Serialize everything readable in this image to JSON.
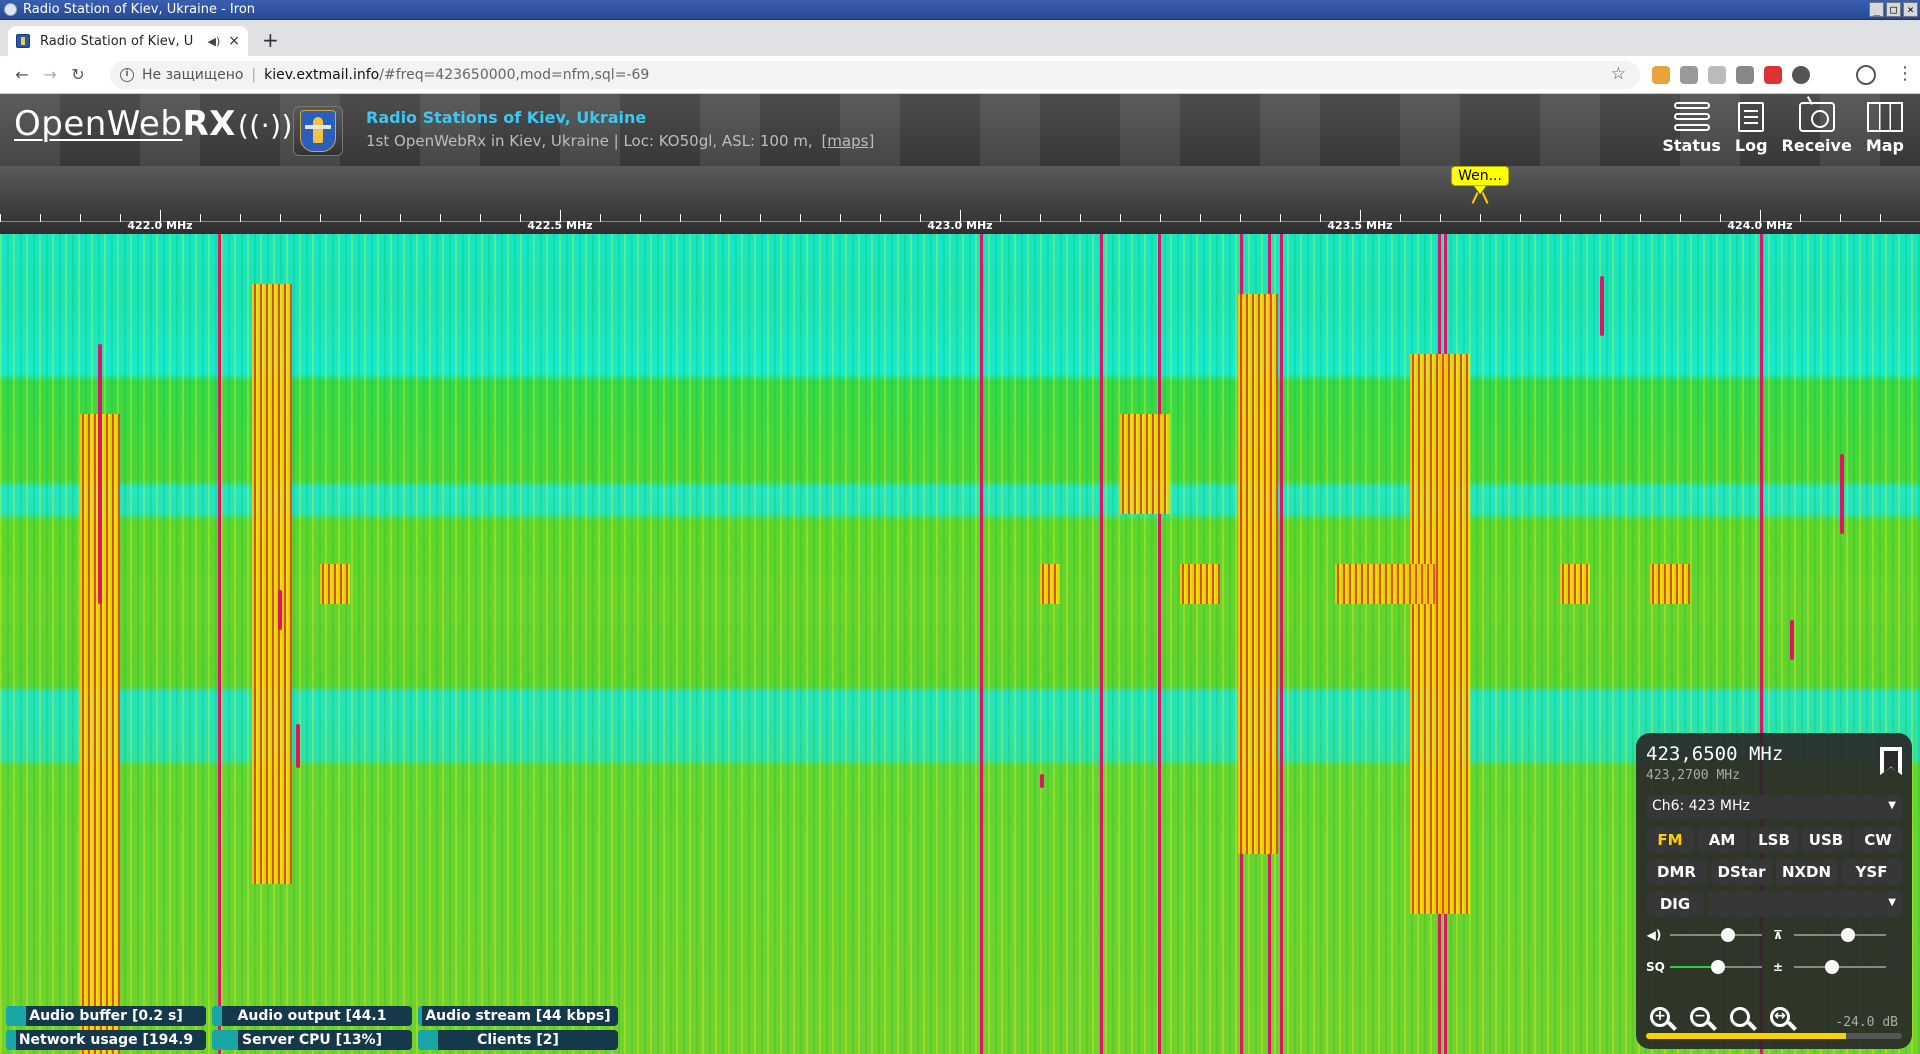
{
  "window": {
    "title": "Radio Station of Kiev, Ukraine - Iron"
  },
  "tab": {
    "title": "Radio Station of Kiev, U",
    "close": "×"
  },
  "newtab": "+",
  "addressbar": {
    "insecure_label": "Не защищено",
    "separator": "|",
    "host": "kiev.extmail.info",
    "path": "/#freq=423650000,mod=nfm,sql=-69"
  },
  "header": {
    "logo_thin": "OpenWeb",
    "logo_bold": "RX",
    "logo_waves": "((·))",
    "title": "Radio Stations of Kiev, Ukraine",
    "description": "1st OpenWebRx in Kiev, Ukraine | Loc: KO50gl, ASL: 100 m,",
    "maps_link": "[maps]",
    "buttons": [
      {
        "label": "Status"
      },
      {
        "label": "Log"
      },
      {
        "label": "Receive"
      },
      {
        "label": "Map"
      }
    ]
  },
  "scale": {
    "labels": [
      "422.0 MHz",
      "422.5 MHz",
      "423.0 MHz",
      "423.5 MHz",
      "424.0 MHz"
    ],
    "bookmark_label": "Wen..."
  },
  "receiver": {
    "frequency": "423,6500 MHz",
    "offset_frequency": "423,2700 MHz",
    "channel_select": "Ch6: 423 MHz",
    "modes_row1": [
      "FM",
      "AM",
      "LSB",
      "USB",
      "CW"
    ],
    "modes_row2": [
      "DMR",
      "DStar",
      "NXDN",
      "YSF"
    ],
    "dig_label": "DIG",
    "active_mode": "FM",
    "volume_level": 0.65,
    "squelch_level": 0.52,
    "gain_level": 0.4,
    "ns_level": 0.6,
    "smeter_label": "-24.0 dB",
    "smeter_level": 0.78
  },
  "status": {
    "audio_buffer": {
      "label": "Audio buffer [0.2 s]",
      "level": 0.1
    },
    "audio_output": {
      "label": "Audio output [44.1",
      "level": 0.05
    },
    "audio_stream": {
      "label": "Audio stream [44 kbps]",
      "level": 0.02
    },
    "network_usage": {
      "label": "Network usage [194.9",
      "level": 0.05
    },
    "server_cpu": {
      "label": "Server CPU [13%]",
      "level": 0.13
    },
    "clients": {
      "label": "Clients [2]",
      "level": 0.1
    }
  },
  "colors": {
    "accent_title": "#3ec7f0",
    "active_mode": "#ffd000",
    "bookmark": "#ffff00",
    "status_fill": "#18a7a6"
  }
}
